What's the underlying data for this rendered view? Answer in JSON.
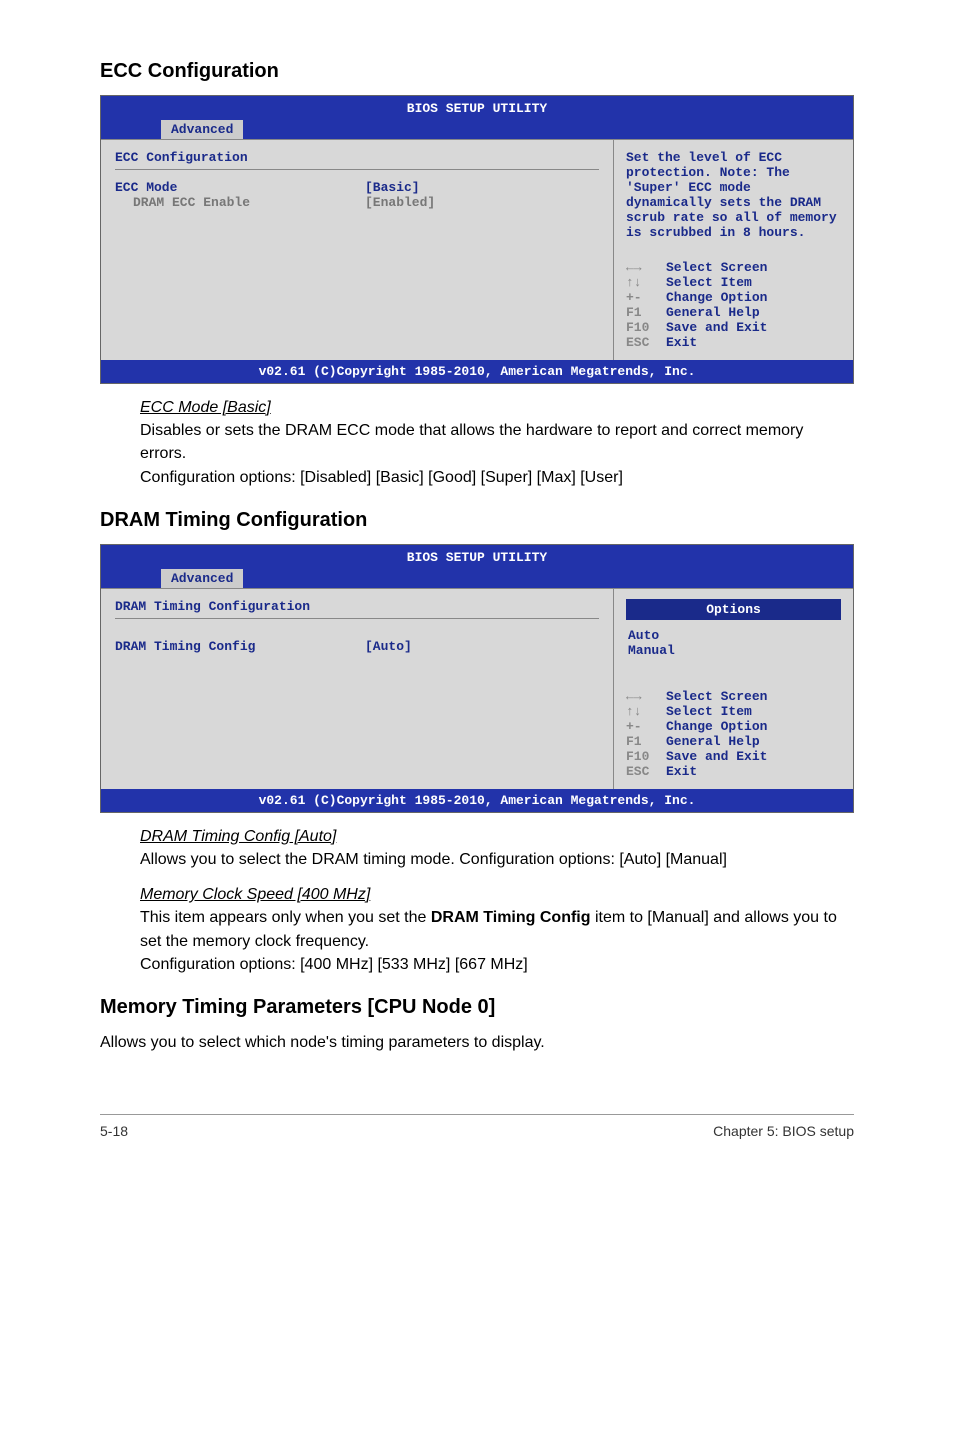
{
  "sections": {
    "ecc_title": "ECC Configuration",
    "dram_title": "DRAM Timing Configuration",
    "memtiming_title": "Memory Timing Parameters [CPU Node 0]"
  },
  "bios_common": {
    "title": "BIOS SETUP UTILITY",
    "tab": "Advanced",
    "footer": "v02.61 (C)Copyright 1985-2010, American Megatrends, Inc.",
    "keys": [
      {
        "key": "←→",
        "label": "Select Screen"
      },
      {
        "key": "↑↓",
        "label": "Select Item"
      },
      {
        "key": "+-",
        "label": "Change Option"
      },
      {
        "key": "F1",
        "label": "General Help"
      },
      {
        "key": "F10",
        "label": "Save and Exit"
      },
      {
        "key": "ESC",
        "label": "Exit"
      }
    ]
  },
  "ecc_panel": {
    "heading": "ECC Configuration",
    "items": [
      {
        "label": "ECC Mode",
        "value": "[Basic]",
        "sub": false
      },
      {
        "label": "DRAM ECC Enable",
        "value": "[Enabled]",
        "sub": true
      }
    ],
    "help": "Set the level of ECC protection. Note: The 'Super' ECC mode dynamically sets the DRAM scrub rate so all of memory is scrubbed in 8 hours."
  },
  "ecc_desc": {
    "title": "ECC Mode [Basic]",
    "body1": "Disables or sets the DRAM ECC mode that allows the hardware to report and correct memory errors.",
    "body2": "Configuration options: [Disabled] [Basic] [Good] [Super] [Max] [User]"
  },
  "dram_panel": {
    "heading": "DRAM Timing Configuration",
    "item": {
      "label": "DRAM Timing Config",
      "value": "[Auto]"
    },
    "options_header": "Options",
    "options": [
      "Auto",
      "Manual"
    ]
  },
  "dram_desc1": {
    "title": "DRAM Timing Config [Auto]",
    "body": "Allows you to select the DRAM timing mode. Configuration options: [Auto] [Manual]"
  },
  "dram_desc2": {
    "title": "Memory Clock Speed [400 MHz]",
    "body_pre": "This item appears only when you set the ",
    "body_bold": "DRAM Timing Config",
    "body_post": " item to [Manual] and allows you to set the memory clock frequency.",
    "body_opts": "Configuration options: [400 MHz] [533 MHz] [667 MHz]"
  },
  "memtiming_desc": "Allows you to select which node's timing parameters to display.",
  "footer": {
    "left": "5-18",
    "right": "Chapter 5: BIOS setup"
  }
}
